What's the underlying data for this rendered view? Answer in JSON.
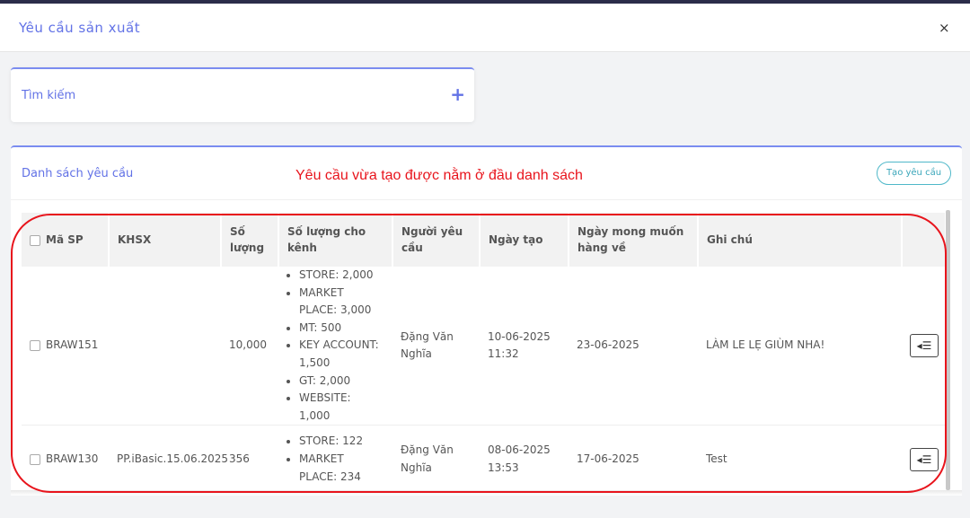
{
  "header": {
    "title": "Yêu cầu sản xuất",
    "close_icon": "×"
  },
  "search": {
    "label": "Tìm kiếm",
    "expand_icon": "+"
  },
  "list": {
    "title": "Danh sách yêu cầu",
    "annotation": "Yêu cầu vừa tạo được nằm ở đầu danh sách",
    "create_button": "Tạo yêu cầu",
    "columns": [
      "Mã SP",
      "KHSX",
      "Số lượng",
      "Số lượng cho kênh",
      "Người yêu cầu",
      "Ngày tạo",
      "Ngày mong muốn hàng về",
      "Ghi chú"
    ],
    "rows": [
      {
        "code": "BRAW151",
        "khsx": "",
        "qty": "10,000",
        "channels": [
          "STORE: 2,000",
          "MARKET PLACE: 3,000",
          "MT: 500",
          "KEY ACCOUNT: 1,500",
          "GT: 2,000",
          "WEBSITE: 1,000"
        ],
        "requester": "Đặng Văn Nghĩa",
        "created": "10-06-2025 11:32",
        "expected": "23-06-2025",
        "note": "LÀM LE LẸ GIÙM NHA!",
        "action_icon": "◂☰"
      },
      {
        "code": "BRAW130",
        "khsx": "PP.iBasic.15.06.2025",
        "qty": "356",
        "channels": [
          "STORE: 122",
          "MARKET PLACE: 234"
        ],
        "requester": "Đặng Văn Nghĩa",
        "created": "08-06-2025 13:53",
        "expected": "17-06-2025",
        "note": "Test",
        "action_icon": "◂☰"
      }
    ]
  },
  "colors": {
    "accent": "#6272e6",
    "annotation": "#e8141c",
    "button": "#3aa6ba"
  }
}
